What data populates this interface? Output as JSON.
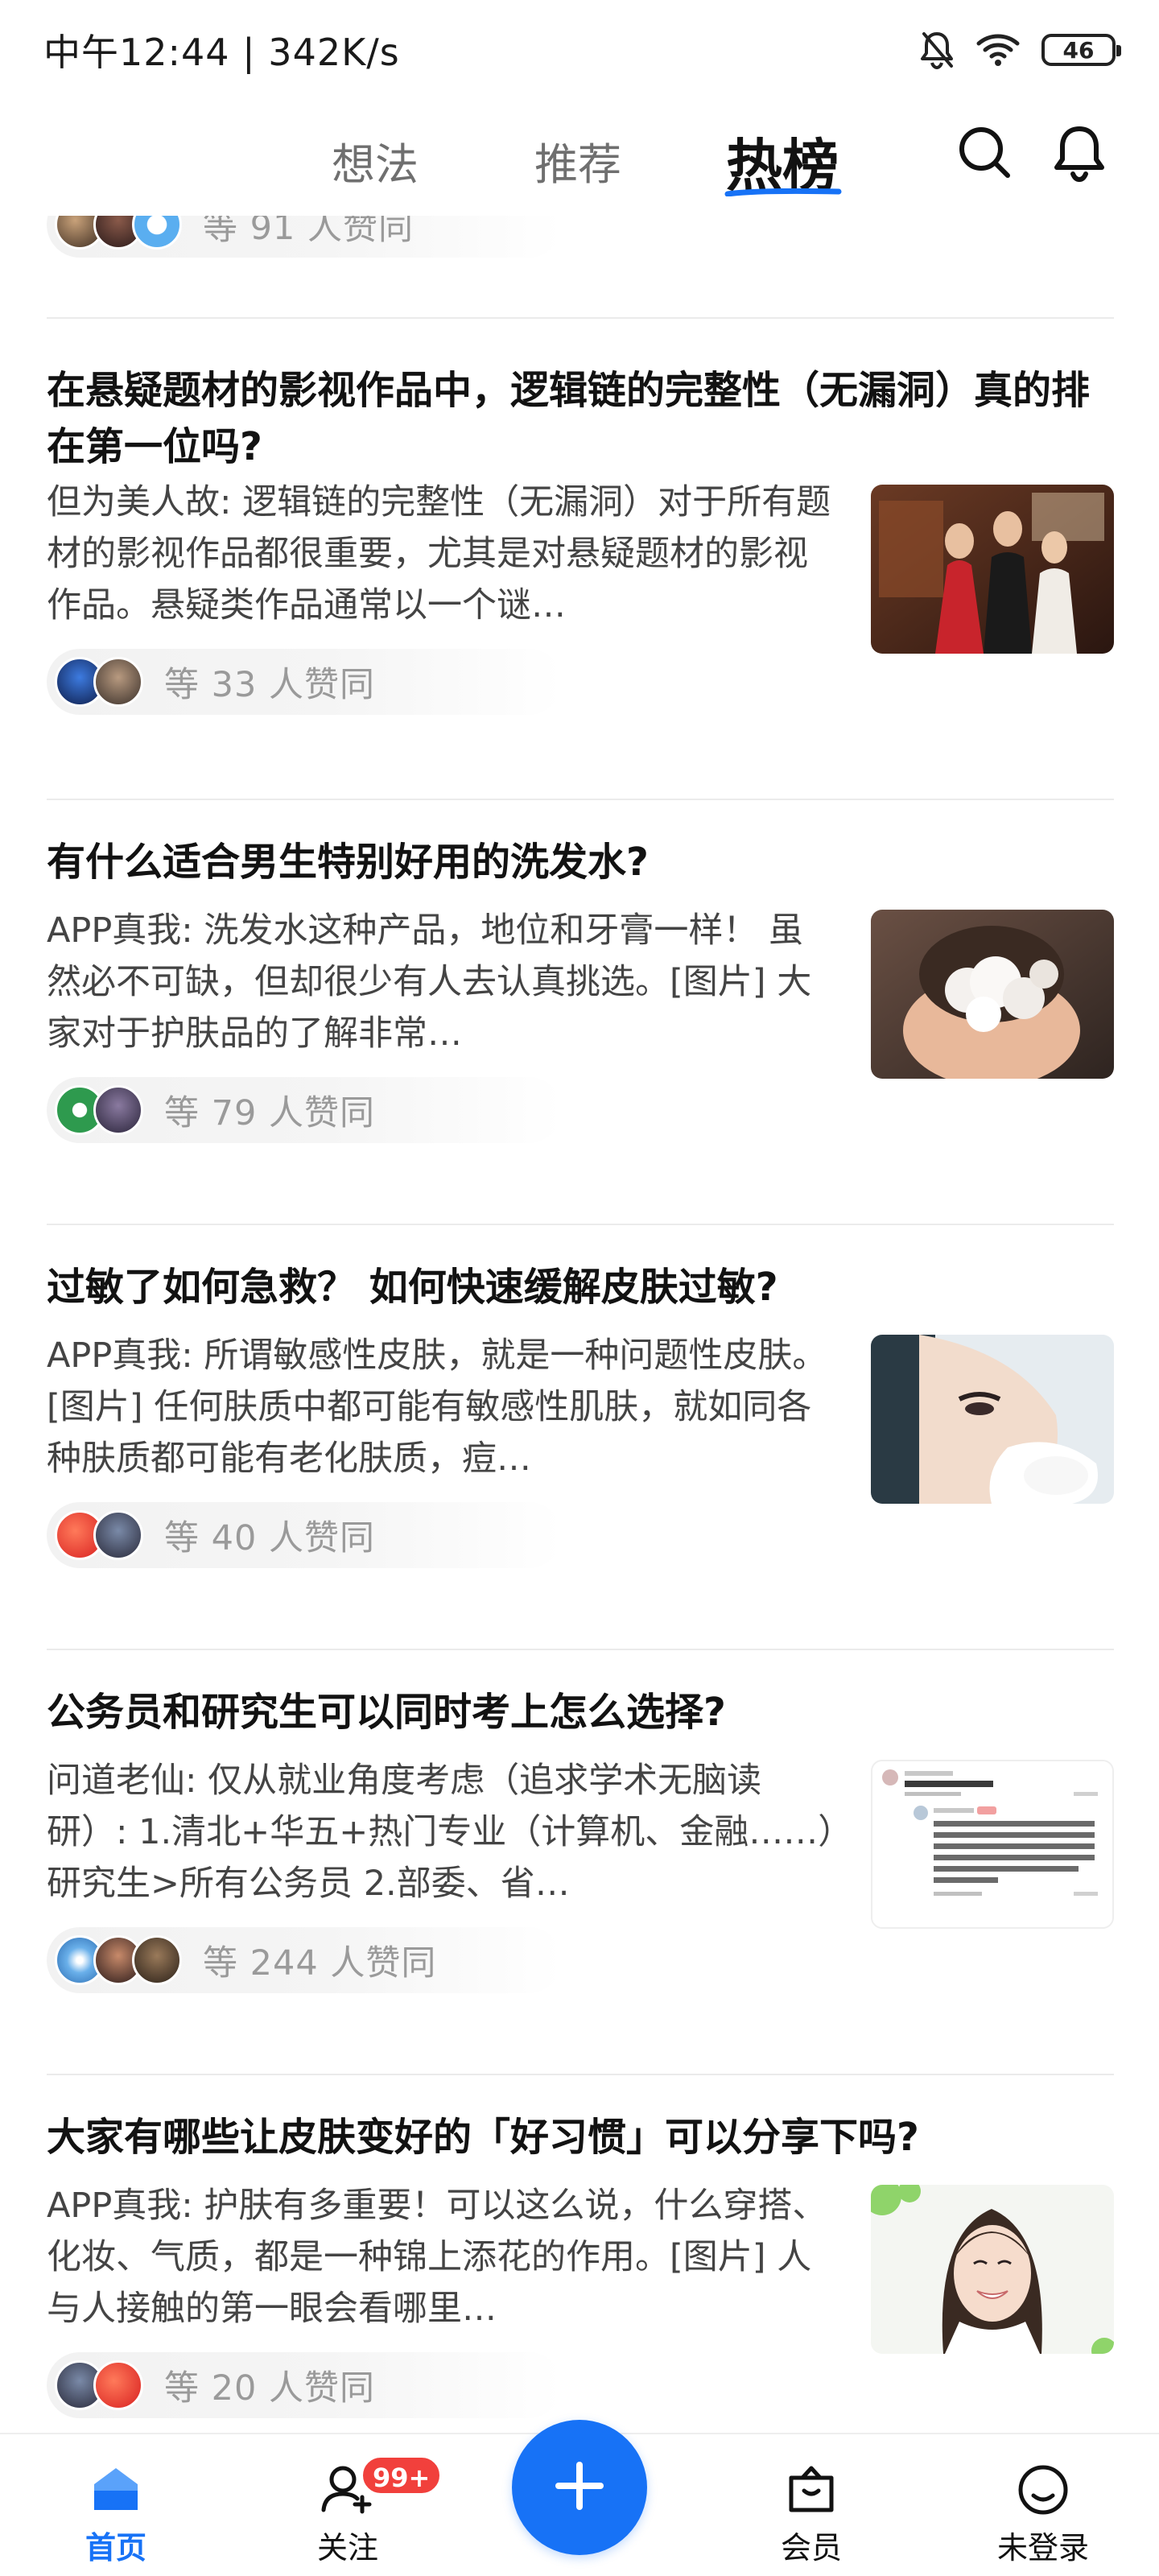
{
  "status_bar": {
    "time_speed": "中午12:44 | 342K/s",
    "battery": "46"
  },
  "top_nav": {
    "tabs": [
      {
        "label": "想法",
        "active": false
      },
      {
        "label": "推荐",
        "active": false
      },
      {
        "label": "热榜",
        "active": true
      }
    ],
    "search_icon": "search-icon",
    "bell_icon": "bell-icon",
    "accent_color": "#1772f6"
  },
  "feed": {
    "partial_top_likes": "等 91 人赞同",
    "cards": [
      {
        "title": "在悬疑题材的影视作品中，逻辑链的完整性（无漏洞）真的排在第一位吗?",
        "excerpt": "但为美人故: 逻辑链的完整性（无漏洞）对于所有题材的影视作品都很重要，尤其是对悬疑题材的影视作品。悬疑类作品通常以一个谜…",
        "likes": "等 33 人赞同",
        "thumbnail": "drama-scene-photo"
      },
      {
        "title": "有什么适合男生特别好用的洗发水?",
        "excerpt": "APP真我: 洗发水这种产品，地位和牙膏一样！ 虽然必不可缺，但却很少有人去认真挑选。[图片] 大家对于护肤品的了解非常…",
        "likes": "等 79 人赞同",
        "thumbnail": "shampoo-foam-photo"
      },
      {
        "title": "过敏了如何急救？ 如何快速缓解皮肤过敏?",
        "excerpt": "APP真我: 所谓敏感性皮肤，就是一种问题性皮肤。[图片] 任何肤质中都可能有敏感性肌肤，就如同各种肤质都可能有老化肤质，痘…",
        "likes": "等 40 人赞同",
        "thumbnail": "face-cleansing-photo"
      },
      {
        "title": "公务员和研究生可以同时考上怎么选择?",
        "excerpt": "问道老仙: 仅从就业角度考虑（追求学术无脑读研）: 1.清北+华五+热门专业（计算机、金融……）研究生>所有公务员 2.部委、省…",
        "likes": "等 244 人赞同",
        "thumbnail": "comment-screenshot"
      },
      {
        "title": "大家有哪些让皮肤变好的「好习惯」可以分享下吗?",
        "excerpt": "APP真我: 护肤有多重要！可以这么说，什么穿搭、化妆、气质，都是一种锦上添花的作用。[图片] 人与人接触的第一眼会看哪里…",
        "likes": "等 20 人赞同",
        "thumbnail": "smiling-woman-photo"
      }
    ]
  },
  "bottom_nav": {
    "items": [
      {
        "label": "首页",
        "active": true
      },
      {
        "label": "关注",
        "badge": "99+"
      },
      {
        "label": "会员"
      },
      {
        "label": "未登录"
      }
    ],
    "fab_icon": "plus-icon"
  }
}
